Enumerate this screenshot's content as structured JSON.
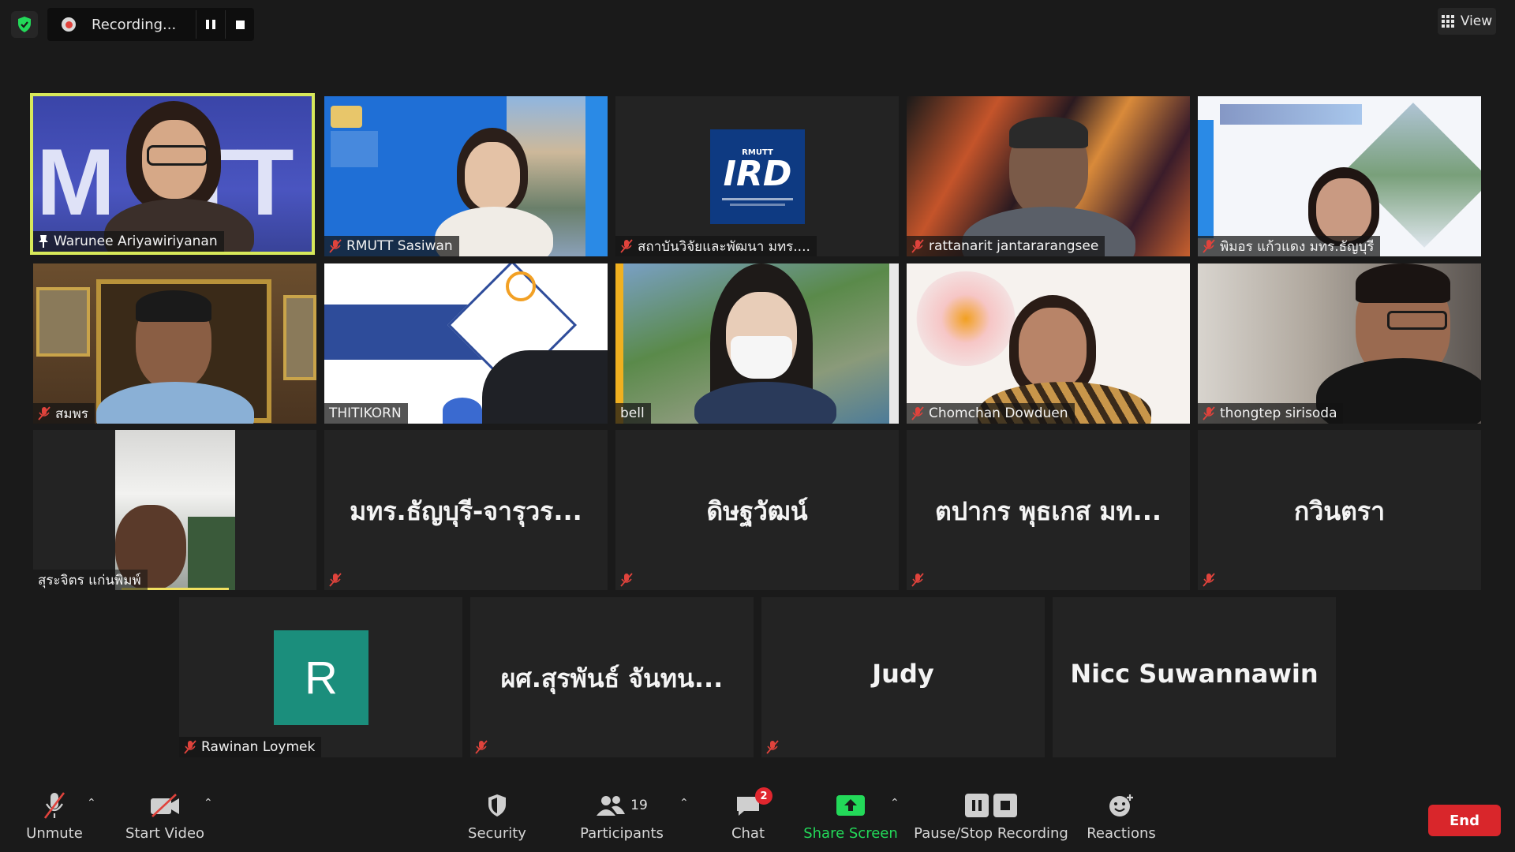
{
  "topbar": {
    "recording_text": "Recording...",
    "view_label": "View"
  },
  "colors": {
    "accent_green": "#23d959",
    "active_speaker_border": "#d7e85a",
    "mute_red": "#e0433c",
    "end_red": "#d9262b"
  },
  "tiles": [
    {
      "name": "Warunee Ariyawiriyanan"
    },
    {
      "name": "RMUTT Sasiwan"
    },
    {
      "name": "สถาบันวิจัยและพัฒนา มทร...."
    },
    {
      "name": "rattanarit jantararangsee"
    },
    {
      "name": "พิมอร แก้วแดง มทร.ธัญบุรี"
    },
    {
      "name": "สมพร"
    },
    {
      "name": "THITIKORN"
    },
    {
      "name": "bell"
    },
    {
      "name": "Chomchan Dowduen"
    },
    {
      "name": "thongtep sirisoda"
    },
    {
      "name": "สุระจิตร แก่นพิมพ์"
    },
    {
      "name": "มทร.ธัญบุรี-จารุวร..."
    },
    {
      "name": "ดิษฐวัฒน์"
    },
    {
      "name": "ตปากร พุธเกส มท..."
    },
    {
      "name": "กวินตรา"
    },
    {
      "name": "Rawinan Loymek",
      "avatar_letter": "R"
    },
    {
      "name": "ผศ.สุรพันธ์ จันทน..."
    },
    {
      "name": "Judy"
    },
    {
      "name": "Nicc Suwannawin"
    }
  ],
  "logos": {
    "ird_text": "IRD",
    "rmutt_text": "RMUTT"
  },
  "toolbar": {
    "unmute": "Unmute",
    "start_video": "Start Video",
    "security": "Security",
    "participants": "Participants",
    "participants_count": "19",
    "chat": "Chat",
    "chat_badge": "2",
    "share_screen": "Share Screen",
    "pause_stop": "Pause/Stop Recording",
    "reactions": "Reactions",
    "end": "End"
  }
}
